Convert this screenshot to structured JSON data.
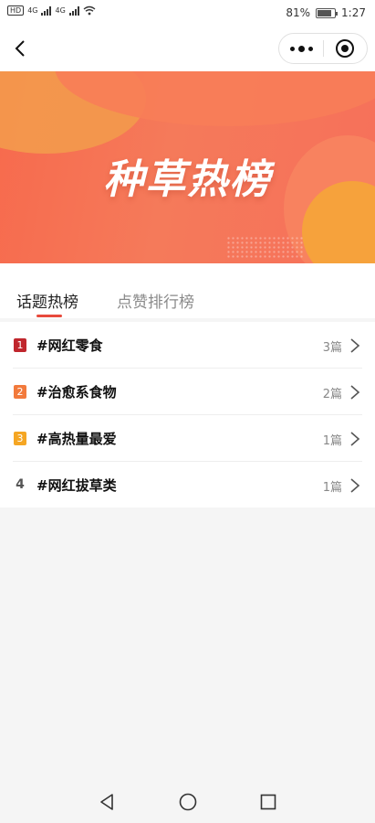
{
  "status_bar": {
    "hd": "HD",
    "network1": "4G",
    "network2": "4G",
    "battery_percent": "81%",
    "battery_level": 0.81,
    "time": "1:27"
  },
  "nav": {
    "back_icon": "chevron-left-icon",
    "more_icon": "more-dots-icon",
    "close_icon": "target-icon"
  },
  "banner": {
    "title": "种草热榜"
  },
  "tabs": [
    {
      "label": "话题热榜",
      "active": true
    },
    {
      "label": "点赞排行榜",
      "active": false
    }
  ],
  "topics": [
    {
      "rank": "1",
      "title": "#网红零食",
      "count": "3篇",
      "badge_color": "#c0262d"
    },
    {
      "rank": "2",
      "title": "#治愈系食物",
      "count": "2篇",
      "badge_color": "#f27a3c"
    },
    {
      "rank": "3",
      "title": "#高热量最爱",
      "count": "1篇",
      "badge_color": "#f5a623"
    },
    {
      "rank": "4",
      "title": "#网红拔草类",
      "count": "1篇",
      "badge_color": ""
    }
  ],
  "colors": {
    "accent": "#e84a3c",
    "banner_start": "#f76a4d",
    "banner_end": "#f6705a"
  }
}
